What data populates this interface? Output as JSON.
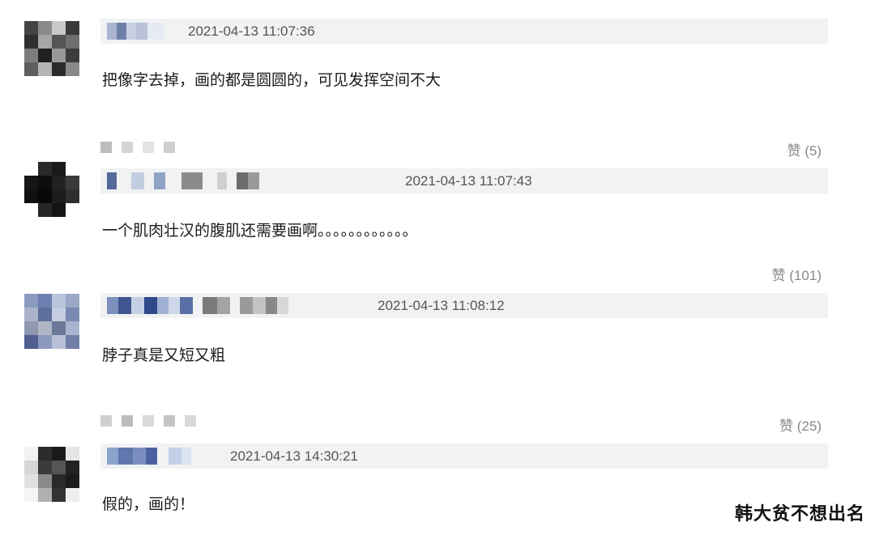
{
  "comments": [
    {
      "time": "2021-04-13 11:07:36",
      "text": "把像字去掉，画的都是圆圆的，可见发挥空间不大"
    },
    {
      "time": "2021-04-13 11:07:43",
      "text": "一个肌肉壮汉的腹肌还需要画啊。。。。。。。。。。。。",
      "like_label": "赞 (5)"
    },
    {
      "time": "2021-04-13 11:08:12",
      "text": "脖子真是又短又粗",
      "like_label": "赞 (101)"
    },
    {
      "time": "2021-04-13 14:30:21",
      "text": "假的，画的！",
      "like_label": "赞 (25)"
    }
  ],
  "watermark": "韩大贫不想出名",
  "colors": {
    "name_bar_bg": "#f0f2f3",
    "timestamp": "#555555",
    "like_text": "#888888"
  },
  "icons": {
    "avatar": "pixelated-avatar",
    "username": "pixelated-username"
  }
}
